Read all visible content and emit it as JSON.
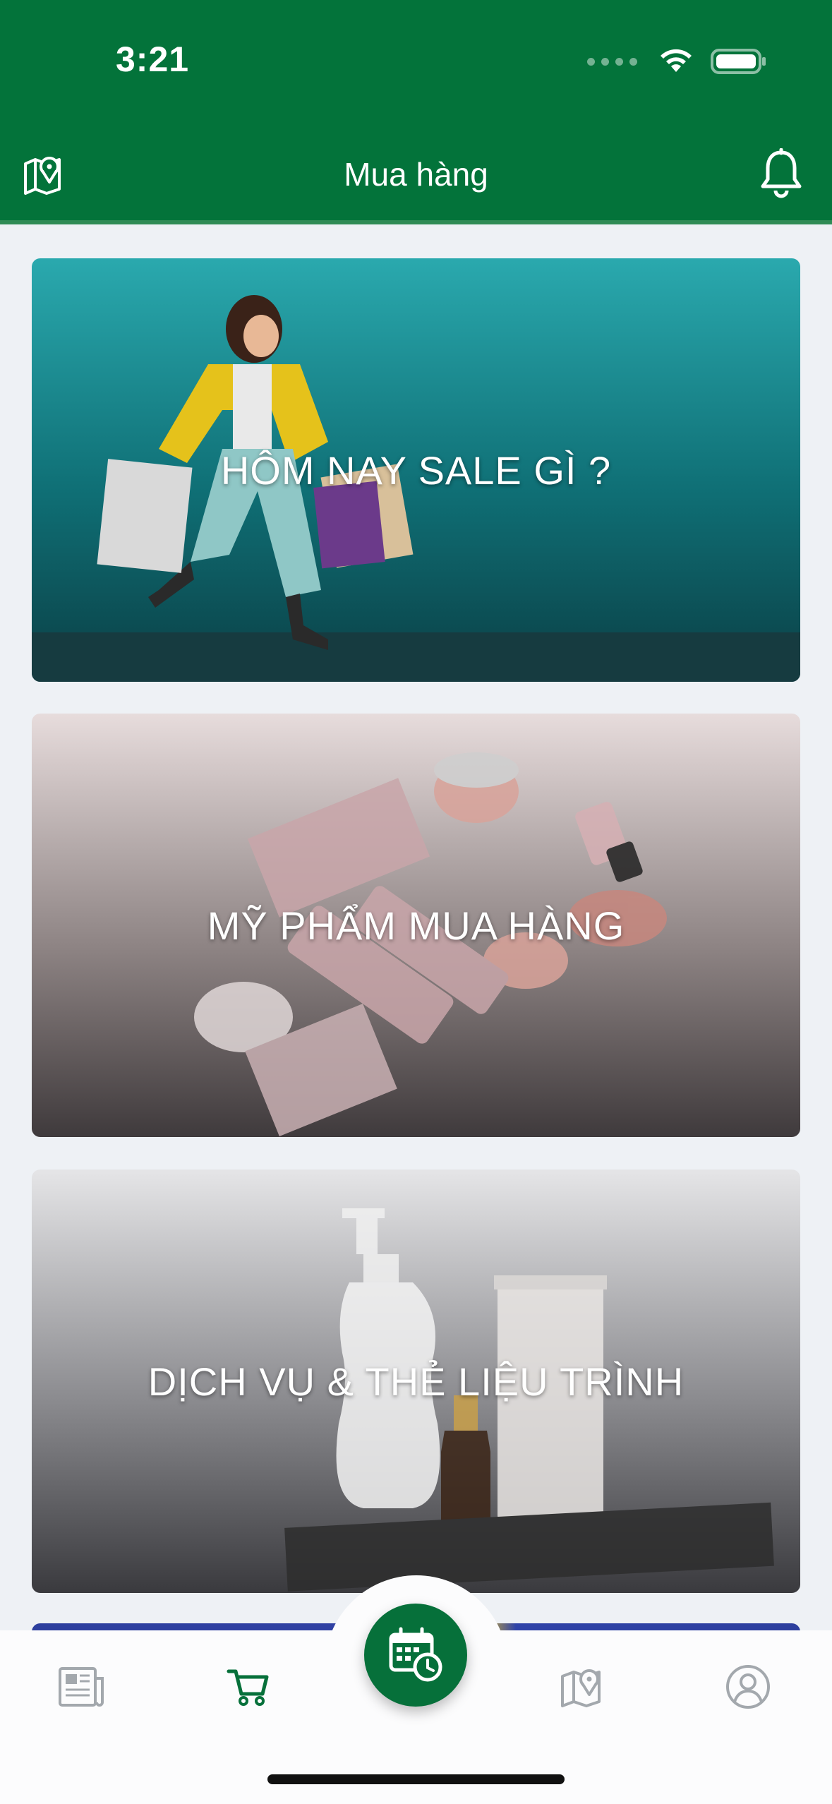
{
  "status_bar": {
    "time": "3:21"
  },
  "header": {
    "title": "Mua hàng",
    "left_icon": "map-pin-icon",
    "right_icon": "bell-icon",
    "background": "#03733a"
  },
  "cards": [
    {
      "label": "HÔM NAY SALE GÌ ?",
      "theme": "teal"
    },
    {
      "label": "MỸ PHẨM MUA HÀNG",
      "theme": "cosmetics"
    },
    {
      "label": "DỊCH VỤ & THẺ LIỆU TRÌNH",
      "theme": "services"
    }
  ],
  "tab_bar": {
    "items": [
      {
        "name": "news",
        "icon": "newspaper-icon",
        "active": false
      },
      {
        "name": "shopping",
        "icon": "cart-icon",
        "active": true
      },
      {
        "name": "booking",
        "icon": "calendar-clock-icon",
        "active": false,
        "center": true
      },
      {
        "name": "map",
        "icon": "map-pin-icon",
        "active": false
      },
      {
        "name": "profile",
        "icon": "user-circle-icon",
        "active": false
      }
    ],
    "active_color": "#06703a",
    "inactive_color": "#9aa0a6"
  }
}
